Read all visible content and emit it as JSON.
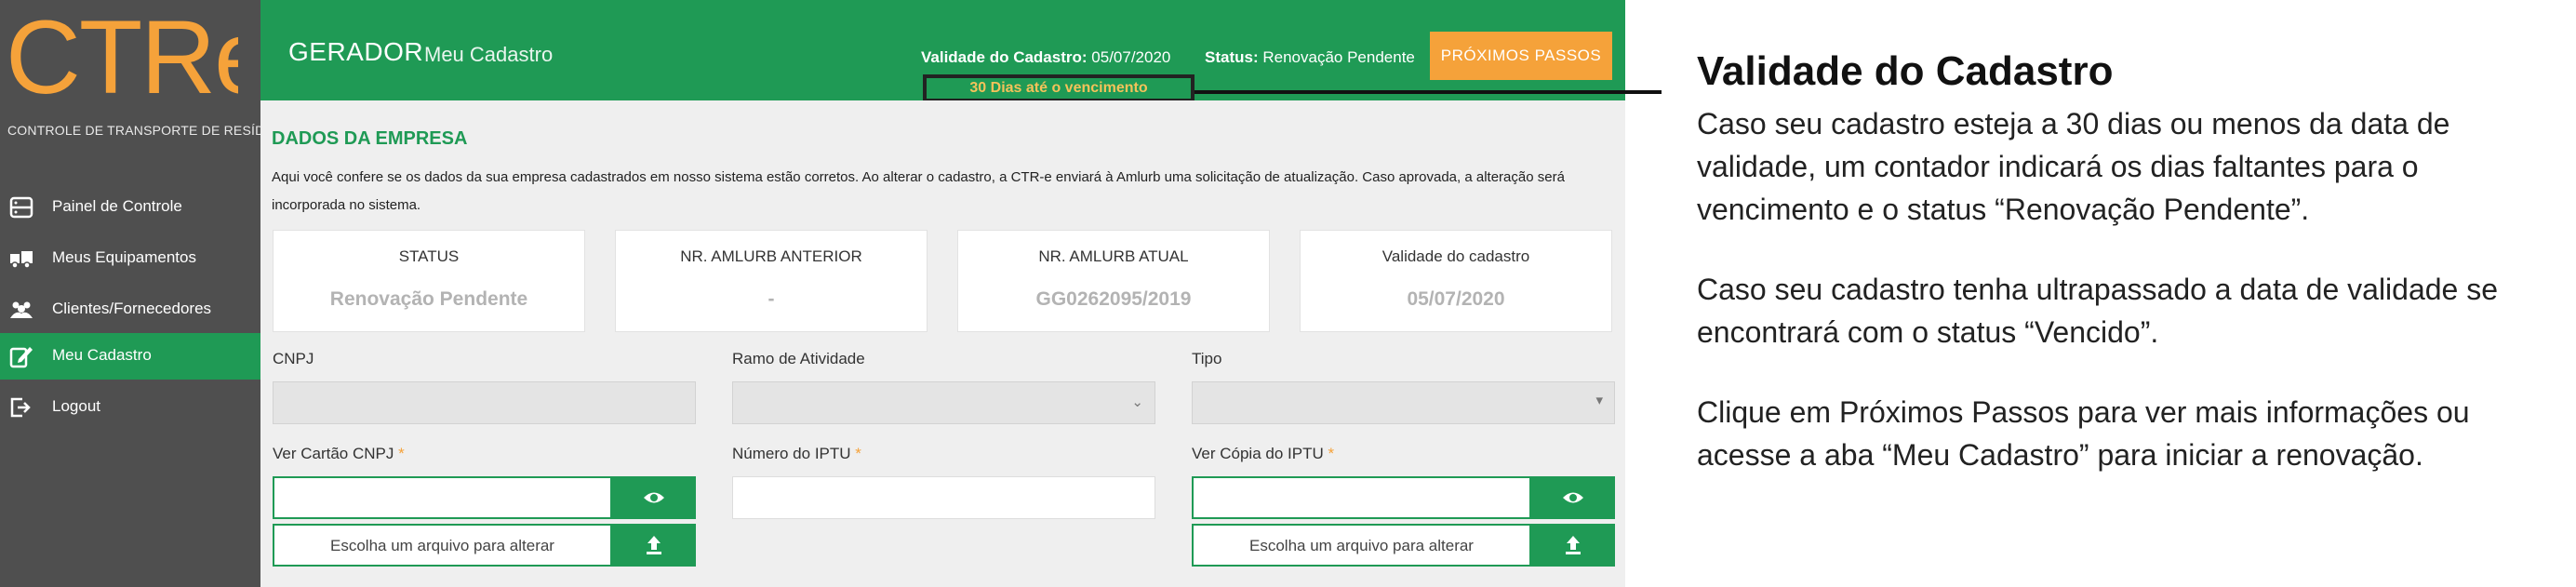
{
  "sidebar": {
    "logo_text": "CTRe",
    "logo_subtitle": "CONTROLE DE TRANSPORTE DE RESÍDUOS",
    "items": [
      {
        "label": "Painel de Controle",
        "icon": "dashboard-icon",
        "active": false
      },
      {
        "label": "Meus Equipamentos",
        "icon": "truck-icon",
        "active": false
      },
      {
        "label": "Clientes/Fornecedores",
        "icon": "users-icon",
        "active": false
      },
      {
        "label": "Meu Cadastro",
        "icon": "edit-icon",
        "active": true
      },
      {
        "label": "Logout",
        "icon": "logout-icon",
        "active": false
      }
    ]
  },
  "header": {
    "title": "GERADOR",
    "subtitle": "Meu Cadastro",
    "validity_label": "Validade do Cadastro:",
    "validity_value": "05/07/2020",
    "status_label": "Status:",
    "status_value": "Renovação Pendente",
    "next_steps_button": "PRÓXIMOS PASSOS",
    "counter_text": "30 Dias até o vencimento"
  },
  "company": {
    "section_title": "DADOS DA EMPRESA",
    "info_text": "Aqui você confere se os dados da sua empresa cadastrados em nosso sistema estão corretos. Ao alterar o cadastro, a CTR-e enviará à Amlurb uma solicitação de atualização. Caso aprovada, a alteração será incorporada no sistema.",
    "cards": [
      {
        "title": "STATUS",
        "value": "Renovação Pendente"
      },
      {
        "title": "NR. AMLURB ANTERIOR",
        "value": "-"
      },
      {
        "title": "NR. AMLURB ATUAL",
        "value": "GG0262095/2019"
      },
      {
        "title": "Validade do cadastro",
        "value": "05/07/2020"
      }
    ]
  },
  "form": {
    "cnpj_label": "CNPJ",
    "ramo_label": "Ramo de Atividade",
    "tipo_label": "Tipo",
    "cartao_label": "Ver Cartão CNPJ",
    "iptu_label": "Número do IPTU",
    "copia_iptu_label": "Ver Cópia do IPTU",
    "required_mark": "*",
    "file_button_label": "Escolha um arquivo para alterar"
  },
  "callout": {
    "title": "Validade do Cadastro",
    "paragraphs": [
      "Caso seu cadastro esteja a 30 dias ou menos da data de validade, um contador indicará os dias faltantes para o vencimento e o status “Renovação Pendente”.",
      "Caso seu cadastro tenha ultrapassado a data de validade se encontrará com o status “Vencido”.",
      "Clique em Próximos Passos para ver mais informações ou acesse a aba “Meu Cadastro” para iniciar a renovação."
    ]
  },
  "colors": {
    "brand_green": "#1f9a55",
    "accent_orange": "#f5a23a",
    "sidebar_bg": "#4f4f4f",
    "counter_text": "#f4c25a"
  }
}
